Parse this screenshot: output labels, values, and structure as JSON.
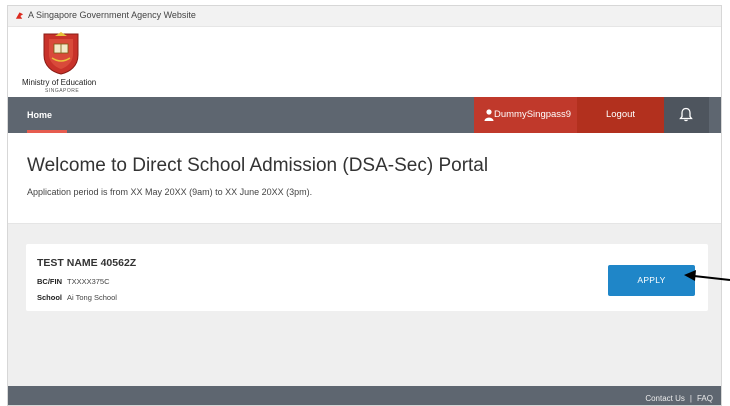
{
  "gov_banner": {
    "text": "A Singapore Government Agency Website"
  },
  "brand": {
    "name": "Ministry of Education",
    "sub": "SINGAPORE"
  },
  "nav": {
    "home": "Home",
    "user": "DummySingpass9",
    "logout": "Logout",
    "icons": {
      "user": "person-icon",
      "notifications": "bell-icon"
    }
  },
  "welcome": {
    "title": "Welcome to Direct School Admission (DSA-Sec) Portal",
    "subtitle": "Application period is from XX May 20XX (9am) to XX June 20XX (3pm)."
  },
  "student": {
    "name": "TEST NAME 40562Z",
    "fin_label": "BC/FIN",
    "fin_value": "TXXXX375C",
    "school_label": "School",
    "school_value": "Ai Tong School",
    "apply_label": "APPLY"
  },
  "footer": {
    "contact": "Contact Us",
    "separator": "|",
    "faq": "FAQ"
  },
  "colors": {
    "nav_bg": "#5e6670",
    "user_bg": "#c0392b",
    "logout_bg": "#b2301e",
    "apply_bg": "#1f86c8",
    "home_underline": "#e65c4f"
  }
}
